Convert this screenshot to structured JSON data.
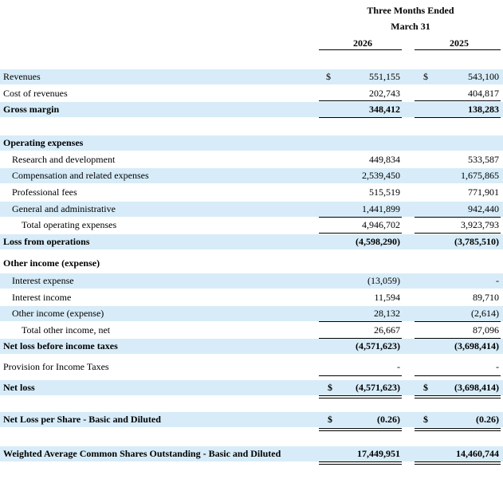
{
  "header": {
    "period_line1": "Three Months Ended",
    "period_line2": "March 31",
    "year1": "2026",
    "year2": "2025"
  },
  "rows": {
    "revenues": {
      "label": "Revenues",
      "cur": "$",
      "v1": "551,155",
      "v2": "543,100"
    },
    "cost_of_revenues": {
      "label": "Cost of revenues",
      "v1": "202,743",
      "v2": "404,817"
    },
    "gross_margin": {
      "label": "Gross margin",
      "v1": "348,412",
      "v2": "138,283"
    },
    "operating_expenses": {
      "label": "Operating expenses"
    },
    "research": {
      "label": "Research and development",
      "v1": "449,834",
      "v2": "533,587"
    },
    "compensation": {
      "label": "Compensation and related expenses",
      "v1": "2,539,450",
      "v2": "1,675,865"
    },
    "professional_fees": {
      "label": "Professional fees",
      "v1": "515,519",
      "v2": "771,901"
    },
    "general_admin": {
      "label": "General and administrative",
      "v1": "1,441,899",
      "v2": "942,440"
    },
    "total_opex": {
      "label": "Total operating expenses",
      "v1": "4,946,702",
      "v2": "3,923,793"
    },
    "loss_from_operations": {
      "label": "Loss from operations",
      "v1": "(4,598,290)",
      "v2": "(3,785,510)"
    },
    "other_income_header": {
      "label": "Other income (expense)"
    },
    "interest_expense": {
      "label": "Interest expense",
      "v1": "(13,059)",
      "v2": "-"
    },
    "interest_income": {
      "label": "Interest income",
      "v1": "11,594",
      "v2": "89,710"
    },
    "other_income": {
      "label": "Other income (expense)",
      "v1": "28,132",
      "v2": "(2,614)"
    },
    "total_other": {
      "label": "Total other income, net",
      "v1": "26,667",
      "v2": "87,096"
    },
    "net_loss_before_tax": {
      "label": "Net loss before income taxes",
      "v1": "(4,571,623)",
      "v2": "(3,698,414)"
    },
    "provision": {
      "label": "Provision for Income Taxes",
      "v1": "-",
      "v2": "-"
    },
    "net_loss": {
      "label": "Net loss",
      "cur": "$",
      "v1": "(4,571,623)",
      "v2": "(3,698,414)"
    },
    "eps": {
      "label": "Net Loss per Share - Basic and Diluted",
      "cur": "$",
      "v1": "(0.26)",
      "v2": "(0.26)"
    },
    "weighted_shares": {
      "label": "Weighted Average Common Shares Outstanding - Basic and Diluted",
      "v1": "17,449,951",
      "v2": "14,460,744"
    }
  },
  "colors": {
    "row_shade": "#d7ecf8"
  }
}
